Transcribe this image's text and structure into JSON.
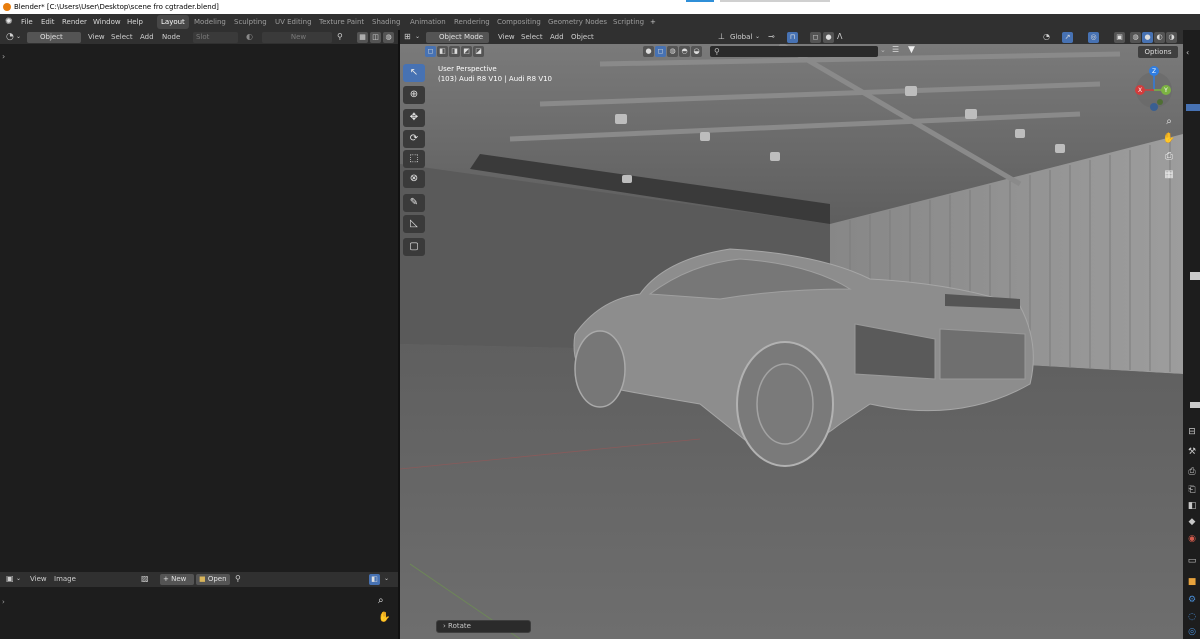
{
  "window": {
    "title": "Blender* [C:\\Users\\User\\Desktop\\scene fro cgtrader.blend]"
  },
  "menubar": {
    "items": [
      "File",
      "Edit",
      "Render",
      "Window",
      "Help"
    ],
    "workspaces": [
      "Layout",
      "Modeling",
      "Sculpting",
      "UV Editing",
      "Texture Paint",
      "Shading",
      "Animation",
      "Rendering",
      "Compositing",
      "Geometry Nodes",
      "Scripting"
    ],
    "add_tab": "+"
  },
  "left_editor": {
    "header": {
      "type_select": "Object",
      "menus": [
        "View",
        "Select",
        "Add",
        "Node"
      ],
      "slot": "Slot",
      "new_label": "New"
    }
  },
  "viewport": {
    "header": {
      "mode": "Object Mode",
      "menus": [
        "View",
        "Select",
        "Add",
        "Object"
      ],
      "transform_orientation": "Global"
    },
    "info_line1": "User Perspective",
    "info_line2": "(103) Audi R8 V10 | Audi R8 V10",
    "options_label": "Options",
    "status_operator": "Rotate",
    "gizmo": {
      "z": "Z",
      "y": "Y",
      "x": "X"
    }
  },
  "bottom_editor": {
    "header": {
      "menus": [
        "View",
        "Image"
      ],
      "new_label": "New",
      "open_label": "Open"
    }
  },
  "colors": {
    "accent": "#4772b3",
    "header_bg": "#303030",
    "editor_bg": "#1d1d1d",
    "viewport_bg": "#6b6b6b",
    "axis_x": "#d23c3c",
    "axis_y": "#7cb342",
    "axis_z": "#2f7de1"
  },
  "icons": [
    "blender-logo-icon",
    "select-box-icon",
    "cursor-icon",
    "move-icon",
    "rotate-icon",
    "scale-icon",
    "transform-icon",
    "annotate-icon",
    "measure-icon",
    "add-cube-icon",
    "zoom-icon",
    "hand-pan-icon",
    "camera-icon",
    "grid-icon",
    "pin-icon",
    "filter-icon"
  ]
}
